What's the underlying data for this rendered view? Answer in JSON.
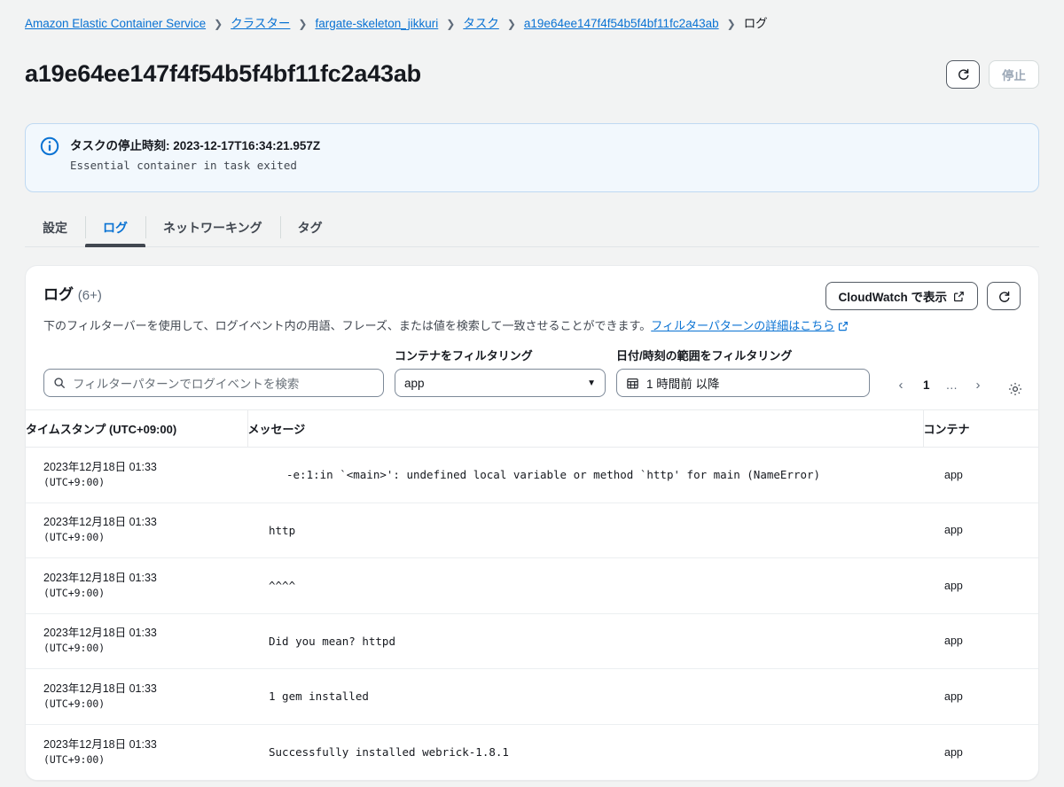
{
  "breadcrumb": {
    "items": [
      {
        "label": "Amazon Elastic Container Service",
        "link": true
      },
      {
        "label": "クラスター",
        "link": true
      },
      {
        "label": "fargate-skeleton_jikkuri",
        "link": true
      },
      {
        "label": "タスク",
        "link": true
      },
      {
        "label": "a19e64ee147f4f54b5f4bf11fc2a43ab",
        "link": true
      },
      {
        "label": "ログ",
        "link": false
      }
    ],
    "separator": "❯"
  },
  "header": {
    "title": "a19e64ee147f4f54b5f4bf11fc2a43ab",
    "refresh_label": "refresh-icon",
    "stop_label": "停止"
  },
  "alert": {
    "icon": "info-icon",
    "title": "タスクの停止時刻: 2023-12-17T16:34:21.957Z",
    "detail": "Essential container in task exited"
  },
  "tabs": [
    {
      "label": "設定",
      "active": false
    },
    {
      "label": "ログ",
      "active": true
    },
    {
      "label": "ネットワーキング",
      "active": false
    },
    {
      "label": "タグ",
      "active": false
    }
  ],
  "log_card": {
    "title": "ログ",
    "count": "(6+)",
    "description_prefix": "下のフィルターバーを使用して、ログイベント内の用語、フレーズ、または値を検索して一致させることができます。",
    "description_link": "フィルターパターンの詳細はこちら",
    "cloudwatch_button": "CloudWatch で表示",
    "refresh_button": "refresh-icon"
  },
  "filters": {
    "search_placeholder": "フィルターパターンでログイベントを検索",
    "search_value": "",
    "container_label": "コンテナをフィルタリング",
    "container_value": "app",
    "daterange_label": "日付/時刻の範囲をフィルタリング",
    "daterange_value": "1 時間前 以降",
    "pagination": {
      "prev": "‹",
      "page": "1",
      "dots": "…",
      "next": "›"
    },
    "settings_icon": "gear-icon"
  },
  "table": {
    "columns": {
      "timestamp": "タイムスタンプ (UTC+09:00)",
      "message": "メッセージ",
      "container": "コンテナ"
    },
    "rows": [
      {
        "date": "2023年12月18日 01:33",
        "zone": "(UTC+9:00)",
        "message": "-e:1:in `<main>': undefined local variable or method `http' for main (NameError)",
        "indent": true,
        "container": "app"
      },
      {
        "date": "2023年12月18日 01:33",
        "zone": "(UTC+9:00)",
        "message": "http",
        "indent": false,
        "container": "app"
      },
      {
        "date": "2023年12月18日 01:33",
        "zone": "(UTC+9:00)",
        "message": "^^^^",
        "indent": false,
        "container": "app"
      },
      {
        "date": "2023年12月18日 01:33",
        "zone": "(UTC+9:00)",
        "message": "Did you mean?  httpd",
        "indent": false,
        "container": "app"
      },
      {
        "date": "2023年12月18日 01:33",
        "zone": "(UTC+9:00)",
        "message": "1 gem installed",
        "indent": false,
        "container": "app"
      },
      {
        "date": "2023年12月18日 01:33",
        "zone": "(UTC+9:00)",
        "message": "Successfully installed webrick-1.8.1",
        "indent": false,
        "container": "app"
      }
    ]
  },
  "colors": {
    "link": "#0972d3",
    "info_border": "#bfd9f2",
    "info_bg": "#f2f8fd",
    "page_bg": "#f2f3f3",
    "tab_active_underline": "#414750"
  }
}
